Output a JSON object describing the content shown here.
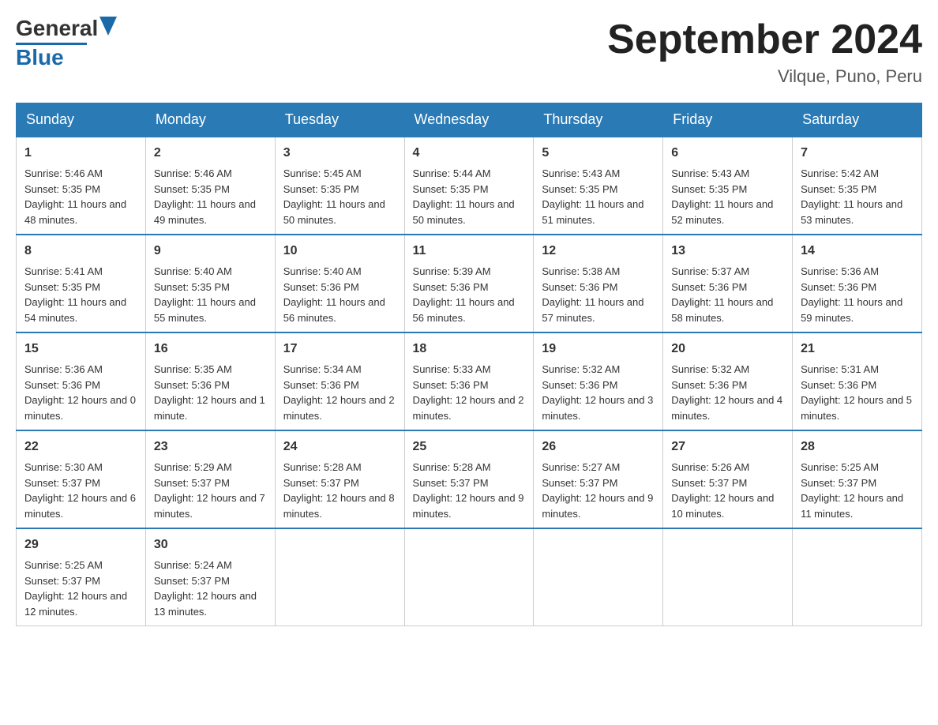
{
  "header": {
    "logo_general": "General",
    "logo_blue": "Blue",
    "title": "September 2024",
    "subtitle": "Vilque, Puno, Peru"
  },
  "days": [
    "Sunday",
    "Monday",
    "Tuesday",
    "Wednesday",
    "Thursday",
    "Friday",
    "Saturday"
  ],
  "weeks": [
    [
      {
        "num": "1",
        "sunrise": "5:46 AM",
        "sunset": "5:35 PM",
        "daylight": "11 hours and 48 minutes."
      },
      {
        "num": "2",
        "sunrise": "5:46 AM",
        "sunset": "5:35 PM",
        "daylight": "11 hours and 49 minutes."
      },
      {
        "num": "3",
        "sunrise": "5:45 AM",
        "sunset": "5:35 PM",
        "daylight": "11 hours and 50 minutes."
      },
      {
        "num": "4",
        "sunrise": "5:44 AM",
        "sunset": "5:35 PM",
        "daylight": "11 hours and 50 minutes."
      },
      {
        "num": "5",
        "sunrise": "5:43 AM",
        "sunset": "5:35 PM",
        "daylight": "11 hours and 51 minutes."
      },
      {
        "num": "6",
        "sunrise": "5:43 AM",
        "sunset": "5:35 PM",
        "daylight": "11 hours and 52 minutes."
      },
      {
        "num": "7",
        "sunrise": "5:42 AM",
        "sunset": "5:35 PM",
        "daylight": "11 hours and 53 minutes."
      }
    ],
    [
      {
        "num": "8",
        "sunrise": "5:41 AM",
        "sunset": "5:35 PM",
        "daylight": "11 hours and 54 minutes."
      },
      {
        "num": "9",
        "sunrise": "5:40 AM",
        "sunset": "5:35 PM",
        "daylight": "11 hours and 55 minutes."
      },
      {
        "num": "10",
        "sunrise": "5:40 AM",
        "sunset": "5:36 PM",
        "daylight": "11 hours and 56 minutes."
      },
      {
        "num": "11",
        "sunrise": "5:39 AM",
        "sunset": "5:36 PM",
        "daylight": "11 hours and 56 minutes."
      },
      {
        "num": "12",
        "sunrise": "5:38 AM",
        "sunset": "5:36 PM",
        "daylight": "11 hours and 57 minutes."
      },
      {
        "num": "13",
        "sunrise": "5:37 AM",
        "sunset": "5:36 PM",
        "daylight": "11 hours and 58 minutes."
      },
      {
        "num": "14",
        "sunrise": "5:36 AM",
        "sunset": "5:36 PM",
        "daylight": "11 hours and 59 minutes."
      }
    ],
    [
      {
        "num": "15",
        "sunrise": "5:36 AM",
        "sunset": "5:36 PM",
        "daylight": "12 hours and 0 minutes."
      },
      {
        "num": "16",
        "sunrise": "5:35 AM",
        "sunset": "5:36 PM",
        "daylight": "12 hours and 1 minute."
      },
      {
        "num": "17",
        "sunrise": "5:34 AM",
        "sunset": "5:36 PM",
        "daylight": "12 hours and 2 minutes."
      },
      {
        "num": "18",
        "sunrise": "5:33 AM",
        "sunset": "5:36 PM",
        "daylight": "12 hours and 2 minutes."
      },
      {
        "num": "19",
        "sunrise": "5:32 AM",
        "sunset": "5:36 PM",
        "daylight": "12 hours and 3 minutes."
      },
      {
        "num": "20",
        "sunrise": "5:32 AM",
        "sunset": "5:36 PM",
        "daylight": "12 hours and 4 minutes."
      },
      {
        "num": "21",
        "sunrise": "5:31 AM",
        "sunset": "5:36 PM",
        "daylight": "12 hours and 5 minutes."
      }
    ],
    [
      {
        "num": "22",
        "sunrise": "5:30 AM",
        "sunset": "5:37 PM",
        "daylight": "12 hours and 6 minutes."
      },
      {
        "num": "23",
        "sunrise": "5:29 AM",
        "sunset": "5:37 PM",
        "daylight": "12 hours and 7 minutes."
      },
      {
        "num": "24",
        "sunrise": "5:28 AM",
        "sunset": "5:37 PM",
        "daylight": "12 hours and 8 minutes."
      },
      {
        "num": "25",
        "sunrise": "5:28 AM",
        "sunset": "5:37 PM",
        "daylight": "12 hours and 9 minutes."
      },
      {
        "num": "26",
        "sunrise": "5:27 AM",
        "sunset": "5:37 PM",
        "daylight": "12 hours and 9 minutes."
      },
      {
        "num": "27",
        "sunrise": "5:26 AM",
        "sunset": "5:37 PM",
        "daylight": "12 hours and 10 minutes."
      },
      {
        "num": "28",
        "sunrise": "5:25 AM",
        "sunset": "5:37 PM",
        "daylight": "12 hours and 11 minutes."
      }
    ],
    [
      {
        "num": "29",
        "sunrise": "5:25 AM",
        "sunset": "5:37 PM",
        "daylight": "12 hours and 12 minutes."
      },
      {
        "num": "30",
        "sunrise": "5:24 AM",
        "sunset": "5:37 PM",
        "daylight": "12 hours and 13 minutes."
      },
      null,
      null,
      null,
      null,
      null
    ]
  ],
  "labels": {
    "sunrise": "Sunrise:",
    "sunset": "Sunset:",
    "daylight": "Daylight:"
  }
}
